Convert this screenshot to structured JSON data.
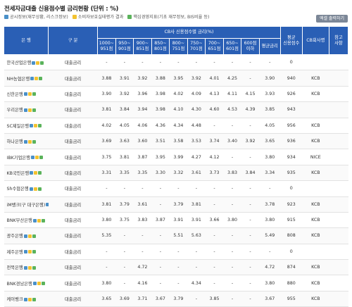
{
  "header": {
    "title": "전세자금대출 신용점수별 금리현황 (단위 : %)",
    "legend": [
      {
        "icon": "blue-box-icon",
        "label": "공시정보(재무상황, 리스크정보)"
      },
      {
        "icon": "yellow-box-icon",
        "label": "소비자보호실태평가 결과"
      },
      {
        "icon": "green-box-icon",
        "label": "핵심경영지표(기초 재무정보, BIS비율 등)"
      }
    ],
    "excel_button": "엑셀 출력하기"
  },
  "table": {
    "col_bank": "은 행",
    "col_type": "구 분",
    "group_header": "CB사 신용점수별 금리(%)",
    "score_columns": [
      "1000~\n951점",
      "950~\n901점",
      "900~\n851점",
      "850~\n801점",
      "800~\n751점",
      "750~\n701점",
      "700~\n651점",
      "650~\n601점",
      "600점\n이하"
    ],
    "col_avg": "평균금리",
    "col_score": "평균\n신용점수",
    "col_cb": "CB회사명",
    "col_ref": "참고\n사항",
    "rows": [
      {
        "bank": "한국산업은행",
        "type": "대출금리",
        "v": [
          "-",
          "-",
          "-",
          "-",
          "-",
          "-",
          "-",
          "-",
          "-"
        ],
        "avg": "-",
        "score": "0",
        "cb": "",
        "ref": ""
      },
      {
        "bank": "NH농협은행",
        "type": "대출금리",
        "v": [
          "3.88",
          "3.91",
          "3.92",
          "3.88",
          "3.95",
          "3.92",
          "4.01",
          "4.25",
          "-"
        ],
        "avg": "3.90",
        "score": "940",
        "cb": "KCB",
        "ref": ""
      },
      {
        "bank": "신한은행",
        "type": "대출금리",
        "v": [
          "3.90",
          "3.92",
          "3.96",
          "3.98",
          "4.02",
          "4.09",
          "4.13",
          "4.11",
          "4.15"
        ],
        "avg": "3.93",
        "score": "926",
        "cb": "KCB",
        "ref": ""
      },
      {
        "bank": "우리은행",
        "type": "대출금리",
        "v": [
          "3.81",
          "3.84",
          "3.94",
          "3.98",
          "4.10",
          "4.30",
          "4.60",
          "4.53",
          "4.39"
        ],
        "avg": "3.85",
        "score": "943",
        "cb": "",
        "ref": ""
      },
      {
        "bank": "SC제일은행",
        "type": "대출금리",
        "v": [
          "4.02",
          "4.05",
          "4.06",
          "4.36",
          "4.34",
          "4.48",
          "-",
          "-",
          "-"
        ],
        "avg": "4.05",
        "score": "956",
        "cb": "KCB",
        "ref": ""
      },
      {
        "bank": "하나은행",
        "type": "대출금리",
        "v": [
          "3.69",
          "3.63",
          "3.60",
          "3.51",
          "3.58",
          "3.53",
          "3.74",
          "3.40",
          "3.92"
        ],
        "avg": "3.65",
        "score": "936",
        "cb": "KCB",
        "ref": ""
      },
      {
        "bank": "IBK기업은행",
        "type": "대출금리",
        "v": [
          "3.75",
          "3.81",
          "3.87",
          "3.95",
          "3.99",
          "4.27",
          "4.12",
          "-",
          "-"
        ],
        "avg": "3.80",
        "score": "934",
        "cb": "NICE",
        "ref": ""
      },
      {
        "bank": "KB국민은행",
        "type": "대출금리",
        "v": [
          "3.31",
          "3.35",
          "3.35",
          "3.30",
          "3.32",
          "3.61",
          "3.73",
          "3.83",
          "3.84"
        ],
        "avg": "3.34",
        "score": "935",
        "cb": "KCB",
        "ref": ""
      },
      {
        "bank": "Sh수협은행",
        "type": "대출금리",
        "v": [
          "-",
          "-",
          "-",
          "-",
          "-",
          "-",
          "-",
          "-",
          "-"
        ],
        "avg": "-",
        "score": "0",
        "cb": "",
        "ref": ""
      },
      {
        "bank": "iM뱅크(구 대구은행)",
        "type": "대출금리",
        "v": [
          "3.81",
          "3.79",
          "3.61",
          "-",
          "3.79",
          "3.81",
          "-",
          "-",
          "-"
        ],
        "avg": "3.78",
        "score": "923",
        "cb": "KCB",
        "ref": ""
      },
      {
        "bank": "BNK부산은행",
        "type": "대출금리",
        "v": [
          "3.80",
          "3.75",
          "3.83",
          "3.87",
          "3.91",
          "3.91",
          "3.66",
          "3.80",
          "-"
        ],
        "avg": "3.80",
        "score": "915",
        "cb": "KCB",
        "ref": ""
      },
      {
        "bank": "광주은행",
        "type": "대출금리",
        "v": [
          "5.35",
          "-",
          "-",
          "-",
          "5.51",
          "5.63",
          "-",
          "-",
          "-"
        ],
        "avg": "5.49",
        "score": "808",
        "cb": "KCB",
        "ref": ""
      },
      {
        "bank": "제주은행",
        "type": "대출금리",
        "v": [
          "-",
          "-",
          "-",
          "-",
          "-",
          "-",
          "-",
          "-",
          "-"
        ],
        "avg": "-",
        "score": "0",
        "cb": "",
        "ref": ""
      },
      {
        "bank": "전북은행",
        "type": "대출금리",
        "v": [
          "-",
          "-",
          "4.72",
          "-",
          "-",
          "-",
          "-",
          "-",
          "-"
        ],
        "avg": "4.72",
        "score": "874",
        "cb": "KCB",
        "ref": ""
      },
      {
        "bank": "BNK경남은행",
        "type": "대출금리",
        "v": [
          "3.80",
          "-",
          "4.16",
          "-",
          "-",
          "4.34",
          "-",
          "-",
          "-"
        ],
        "avg": "3.80",
        "score": "880",
        "cb": "KCB",
        "ref": ""
      },
      {
        "bank": "케이뱅크",
        "type": "대출금리",
        "v": [
          "3.65",
          "3.69",
          "3.71",
          "3.67",
          "3.79",
          "-",
          "3.85",
          "-",
          "-"
        ],
        "avg": "3.67",
        "score": "955",
        "cb": "KCB",
        "ref": ""
      }
    ]
  }
}
